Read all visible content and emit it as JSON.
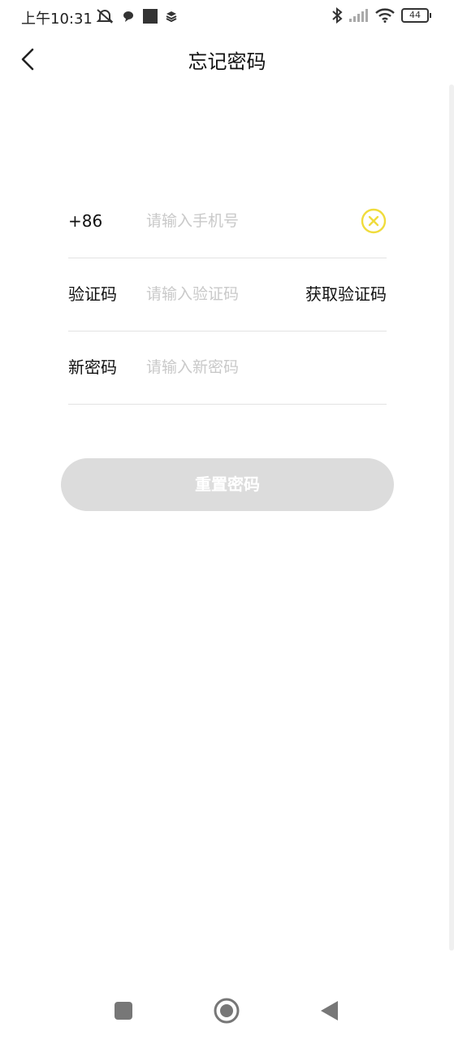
{
  "status_bar": {
    "time": "上午10:31",
    "battery_level": "44",
    "icons_left": [
      "silent-bell-icon",
      "chat-bubble-icon",
      "square-notification-icon",
      "layers-icon"
    ],
    "icons_right": [
      "bluetooth-icon",
      "signal-icon",
      "wifi-icon",
      "battery-icon"
    ]
  },
  "header": {
    "title": "忘记密码"
  },
  "form": {
    "phone": {
      "label": "+86",
      "placeholder": "请输入手机号",
      "value": ""
    },
    "code": {
      "label": "验证码",
      "placeholder": "请输入验证码",
      "value": "",
      "get_code_label": "获取验证码"
    },
    "new_password": {
      "label": "新密码",
      "placeholder": "请输入新密码",
      "value": ""
    }
  },
  "reset_button": {
    "label": "重置密码"
  },
  "colors": {
    "accent_yellow": "#f0dc3c",
    "disabled_button": "#dcdcdc",
    "placeholder": "#c9c9c9",
    "divider": "#e3e3e3"
  }
}
